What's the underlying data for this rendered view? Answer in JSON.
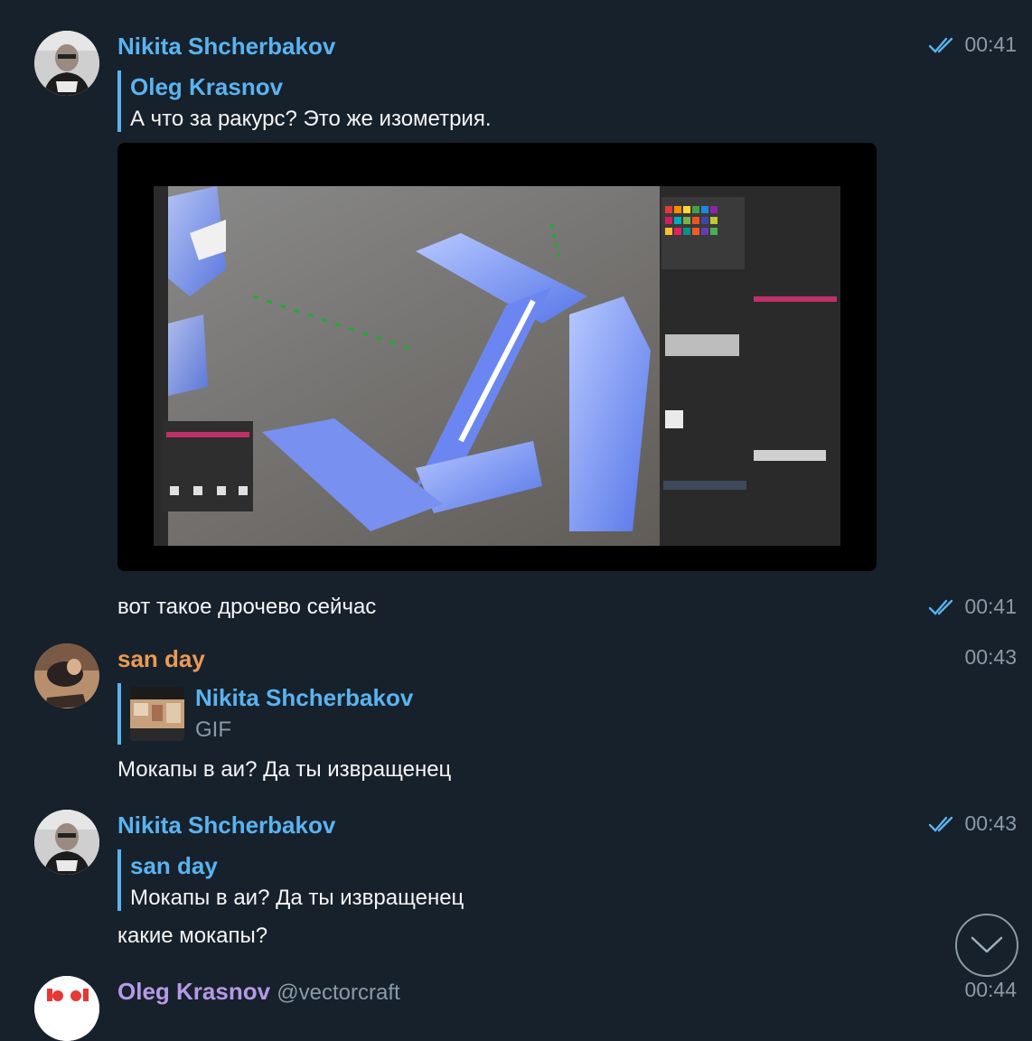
{
  "messages": [
    {
      "sender": "Nikita Shcherbakov",
      "time": "00:41",
      "reply": {
        "name": "Oleg Krasnov",
        "text": "А что за ракурс? Это же изометрия."
      },
      "media": "gif-preview"
    },
    {
      "text": "вот такое дрочево сейчас",
      "time": "00:41"
    },
    {
      "sender": "san day",
      "time": "00:43",
      "reply": {
        "name": "Nikita Shcherbakov",
        "text": "GIF"
      },
      "text": "Мокапы в аи? Да ты извращенец"
    },
    {
      "sender": "Nikita Shcherbakov",
      "time": "00:43",
      "reply": {
        "name": "san day",
        "text": "Мокапы в аи? Да ты извращенец"
      },
      "text": "какие мокапы?"
    },
    {
      "sender": "Oleg Krasnov",
      "username": "@vectorcraft",
      "time": "00:44"
    }
  ],
  "colors": {
    "background": "#17212b",
    "link_blue": "#5ab3f0",
    "orange_name": "#eb9a55",
    "purple_name": "#b59ae6",
    "time_gray": "#8a9aa9"
  },
  "icons": {
    "read_status": "double-check-icon",
    "scroll_down": "chevron-down-icon"
  }
}
